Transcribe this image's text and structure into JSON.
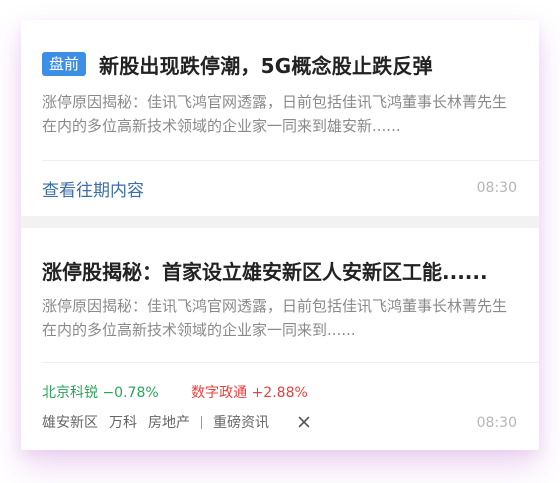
{
  "article_1": {
    "badge": "盘前",
    "title": "新股出现跌停潮，5G概念股止跌反弹",
    "summary": "涨停原因揭秘：佳讯飞鸿官网透露，日前包括佳讯飞鸿董事长林菁先生在内的多位高新技术领域的企业家一同来到雄安新......",
    "view_more": "查看往期内容",
    "time": "08:30"
  },
  "article_2": {
    "title": "涨停股揭秘：首家设立雄安新区人安新区工能......",
    "summary": "涨停原因揭秘：佳讯飞鸿官网透露，日前包括佳讯飞鸿董事长林菁先生在内的多位高新技术领域的企业家一同来到......",
    "stocks": [
      {
        "name": "北京科锐",
        "change": "−0.78%",
        "direction": "down"
      },
      {
        "name": "数字政通",
        "change": "+2.88%",
        "direction": "up"
      }
    ],
    "tags": [
      "雄安新区",
      "万科",
      "房地产"
    ],
    "source": "重磅资讯",
    "close_icon": "close-icon",
    "time": "08:30"
  },
  "colors": {
    "badge_bg": "#3d8fe6",
    "link": "#3d6ea8",
    "stock_down": "#2aa55a",
    "stock_up": "#e8403d"
  }
}
